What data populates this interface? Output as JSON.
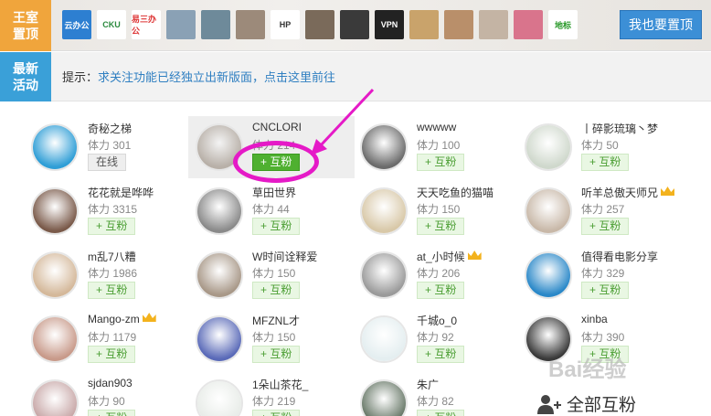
{
  "sidebar_tags": {
    "top": "王室\n置顶",
    "new": "最新\n活动"
  },
  "top_logos": [
    {
      "name": "yun-office-logo",
      "text": "云办公",
      "bg": "#2d7fd1",
      "fg": "#fff"
    },
    {
      "name": "cku-logo",
      "text": "CKU",
      "bg": "#ffffff",
      "fg": "#2b8a3e"
    },
    {
      "name": "easy-office-logo",
      "text": "易三办公",
      "bg": "#ffffff",
      "fg": "#d33"
    },
    {
      "name": "avatar-1",
      "text": "",
      "bg": "#8aa1b5",
      "fg": "#fff"
    },
    {
      "name": "avatar-2",
      "text": "",
      "bg": "#6e8a9a",
      "fg": "#fff"
    },
    {
      "name": "avatar-3",
      "text": "",
      "bg": "#9c8a7a",
      "fg": "#fff"
    },
    {
      "name": "hp-logo",
      "text": "HP",
      "bg": "#ffffff",
      "fg": "#333"
    },
    {
      "name": "avatar-4",
      "text": "",
      "bg": "#7a6a5a",
      "fg": "#fff"
    },
    {
      "name": "avatar-5",
      "text": "",
      "bg": "#3a3a3a",
      "fg": "#fff"
    },
    {
      "name": "vpn-logo",
      "text": "VPN",
      "bg": "#222222",
      "fg": "#fff"
    },
    {
      "name": "avatar-6",
      "text": "",
      "bg": "#c9a36b",
      "fg": "#fff"
    },
    {
      "name": "avatar-7",
      "text": "",
      "bg": "#b98f6a",
      "fg": "#fff"
    },
    {
      "name": "avatar-8",
      "text": "",
      "bg": "#c4b4a4",
      "fg": "#fff"
    },
    {
      "name": "avatar-9",
      "text": "",
      "bg": "#d9748c",
      "fg": "#fff"
    },
    {
      "name": "ditan-logo",
      "text": "地标",
      "bg": "#ffffff",
      "fg": "#2b9a2b"
    }
  ],
  "top_button": "我也要置顶",
  "tip": {
    "label": "提示：",
    "link": "求关注功能已经独立出新版面，点击这里前往"
  },
  "users": [
    [
      {
        "name": "奇秘之梯",
        "stat": "体力 301",
        "action": "在线",
        "state": "online",
        "crown": false,
        "avatar_bg": "#2f9ed6"
      },
      {
        "name": "CNCLORI",
        "stat": "体力 214",
        "action": "+ 互粉",
        "state": "active",
        "crown": false,
        "avatar_bg": "#b8b0a8"
      },
      {
        "name": "wwwww",
        "stat": "体力 100",
        "action": "+ 互粉",
        "state": "normal",
        "crown": false,
        "avatar_bg": "#6b6b6b"
      },
      {
        "name": "丨碎影琉璃丶梦",
        "stat": "体力 50",
        "action": "+ 互粉",
        "state": "normal",
        "crown": false,
        "avatar_bg": "#cfd8cc"
      }
    ],
    [
      {
        "name": "花花就是哗哗",
        "stat": "体力 3315",
        "action": "+ 互粉",
        "state": "normal",
        "crown": false,
        "avatar_bg": "#7a5a4a"
      },
      {
        "name": "草田世界",
        "stat": "体力 44",
        "action": "+ 互粉",
        "state": "normal",
        "crown": false,
        "avatar_bg": "#8a8a8a"
      },
      {
        "name": "天天吃鱼的猫喵",
        "stat": "体力 150",
        "action": "+ 互粉",
        "state": "normal",
        "crown": false,
        "avatar_bg": "#d8c8a8"
      },
      {
        "name": "听羊总傲天师兄",
        "stat": "体力 257",
        "action": "+ 互粉",
        "state": "normal",
        "crown": true,
        "avatar_bg": "#c8b8a8"
      }
    ],
    [
      {
        "name": "m乱7八糟",
        "stat": "体力 1986",
        "action": "+ 互粉",
        "state": "normal",
        "crown": false,
        "avatar_bg": "#d4b89a"
      },
      {
        "name": "W时间诠释爱",
        "stat": "体力 150",
        "action": "+ 互粉",
        "state": "normal",
        "crown": false,
        "avatar_bg": "#a89888"
      },
      {
        "name": "at_小时候",
        "stat": "体力 206",
        "action": "+ 互粉",
        "state": "normal",
        "crown": true,
        "avatar_bg": "#9a9a9a"
      },
      {
        "name": "值得看电影分享",
        "stat": "体力 329",
        "action": "+ 互粉",
        "state": "normal",
        "crown": false,
        "avatar_bg": "#2a88c8"
      }
    ],
    [
      {
        "name": "Mango-zm",
        "stat": "体力 1179",
        "action": "+ 互粉",
        "state": "normal",
        "crown": true,
        "avatar_bg": "#c89a8a"
      },
      {
        "name": "MFZNL才",
        "stat": "体力 150",
        "action": "+ 互粉",
        "state": "normal",
        "crown": false,
        "avatar_bg": "#5a6ab8"
      },
      {
        "name": "千城o_0",
        "stat": "体力 92",
        "action": "+ 互粉",
        "state": "normal",
        "crown": false,
        "avatar_bg": "#e4eef0"
      },
      {
        "name": "xinba",
        "stat": "体力 390",
        "action": "+ 互粉",
        "state": "normal",
        "crown": false,
        "avatar_bg": "#3a3a3a"
      }
    ],
    [
      {
        "name": "sjdan903",
        "stat": "体力 90",
        "action": "+ 互粉",
        "state": "normal",
        "crown": false,
        "avatar_bg": "#c8a8a8"
      },
      {
        "name": "1朵山茶花_",
        "stat": "体力 219",
        "action": "+ 互粉",
        "state": "normal",
        "crown": false,
        "avatar_bg": "#e8ece8"
      },
      {
        "name": "朱广",
        "stat": "体力 82",
        "action": "+ 互粉",
        "state": "normal",
        "crown": false,
        "avatar_bg": "#6a7a6a"
      }
    ]
  ],
  "all_mutual": "全部互粉",
  "watermark": "Bai经验",
  "colors": {
    "accent_orange": "#f0a53c",
    "accent_blue": "#3aa0d8",
    "button_blue": "#3c8fd6",
    "mutual_green": "#4fb030",
    "annotation": "#e51ac7"
  }
}
